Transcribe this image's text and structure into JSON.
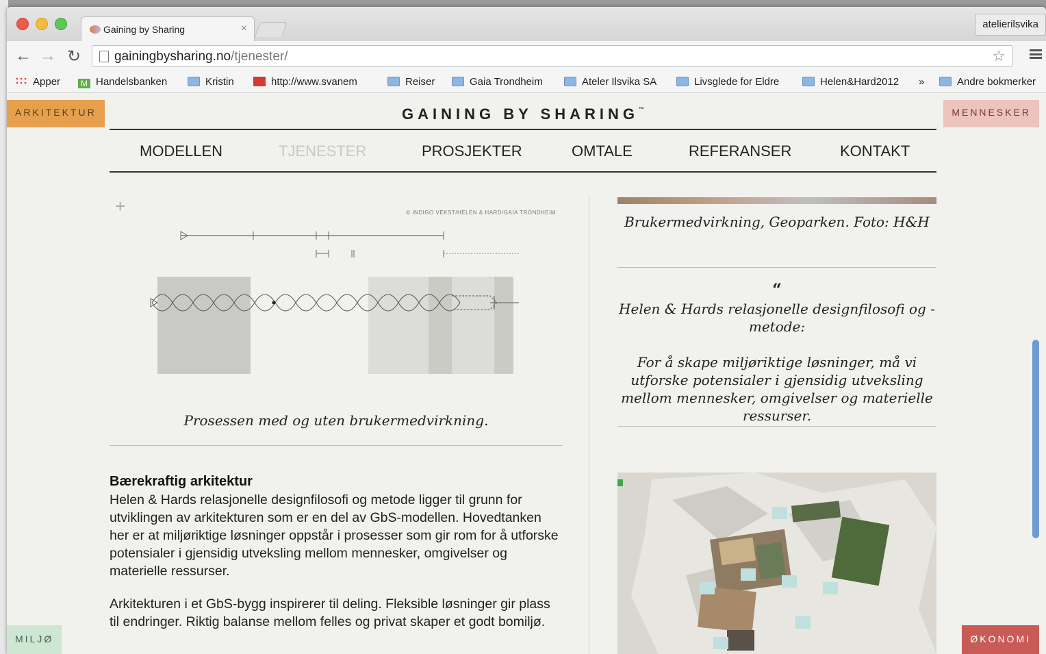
{
  "browser": {
    "tab_title": "Gaining by Sharing",
    "tab_close": "×",
    "profile_name": "atelierilsvika",
    "url_host": "gainingbysharing.no",
    "url_path": "/tjenester/",
    "bookmarks": [
      {
        "label": "Apper",
        "icon": "apps-icon"
      },
      {
        "label": "Handelsbanken",
        "icon": "m-icon"
      },
      {
        "label": "Kristin",
        "icon": "folder-icon"
      },
      {
        "label": "http://www.svanem",
        "icon": "red-bookmark-icon"
      },
      {
        "label": "Reiser",
        "icon": "folder-icon"
      },
      {
        "label": "Gaia Trondheim",
        "icon": "folder-icon"
      },
      {
        "label": "Ateler Ilsvika SA",
        "icon": "folder-icon"
      },
      {
        "label": "Livsglede for Eldre",
        "icon": "folder-icon"
      },
      {
        "label": "Helen&Hard2012",
        "icon": "folder-icon"
      },
      {
        "label": "»",
        "icon": ""
      },
      {
        "label": "Andre bokmerker",
        "icon": "folder-icon"
      }
    ]
  },
  "corners": {
    "arkitektur": "ARKITEKTUR",
    "mennesker": "MENNESKER",
    "miljo": "MILJØ",
    "okonomi": "ØKONOMI"
  },
  "site": {
    "brand": "GAINING BY SHARING",
    "brand_tm": "™",
    "nav": [
      "MODELLEN",
      "TJENESTER",
      "PROSJEKTER",
      "OMTALE",
      "REFERANSER",
      "KONTAKT"
    ],
    "active_nav": "TJENESTER"
  },
  "diagram": {
    "plus": "+",
    "credit": "© INDIGO VEKST/HELEN & HARD/GAIA TRONDHEIM"
  },
  "left": {
    "caption": "Prosessen med og uten brukermedvirkning.",
    "section_title": "Bærekraftig arkitektur",
    "para1": "Helen & Hards relasjonelle designfilosofi og metode ligger til grunn for utviklingen av arkitekturen som er en del av GbS-modellen. Hovedtanken her er at miljøriktige løsninger oppstår i prosesser som gir rom for å utforske potensialer i gjensidig utveksling mellom mennesker, omgivelser og materielle ressurser.",
    "para2": "Arkitekturen i et GbS-bygg inspirerer til deling. Fleksible løsninger gir plass til endringer. Riktig balanse mellom felles og privat skaper et godt bomiljø."
  },
  "right": {
    "photo_caption": "Brukermedvirkning, Geoparken. Foto: H&H",
    "quote_mark": "“",
    "quote_title": "Helen & Hards relasjonelle designfilosofi og -metode:",
    "quote_body": "For å skape miljøriktige løsninger, må vi utforske potensialer i gjensidig utveksling mellom mennesker, omgivelser og materielle ressurser."
  },
  "colors": {
    "arkitektur": "#e6a04d",
    "mennesker": "#ecc3bd",
    "miljo": "#cde7d2",
    "okonomi": "#c95b57"
  }
}
